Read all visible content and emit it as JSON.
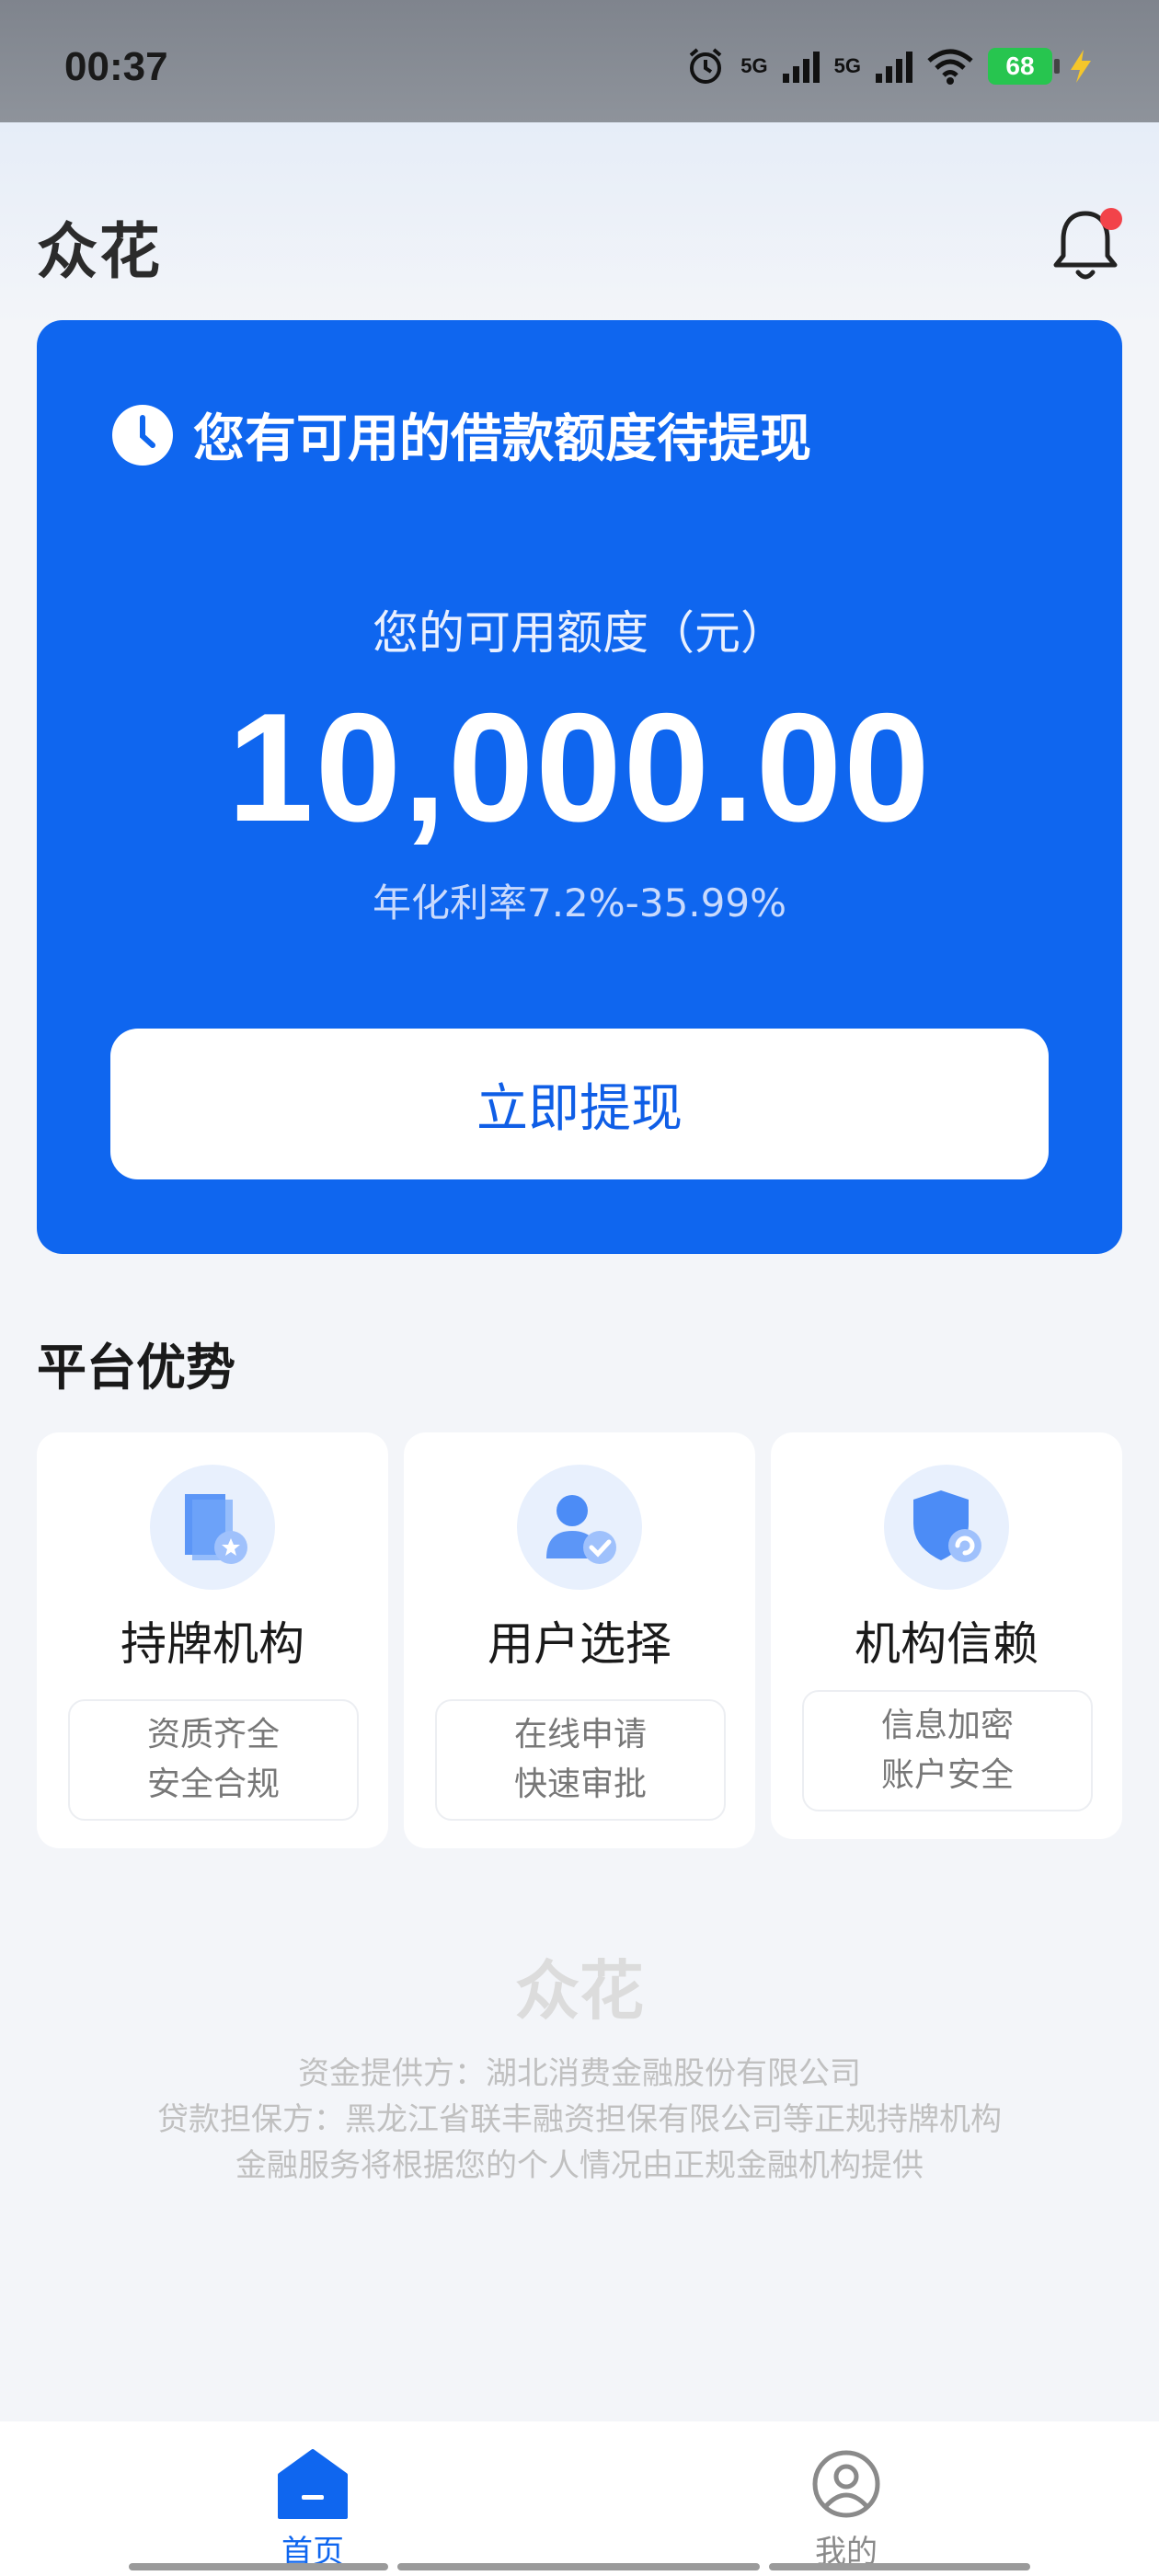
{
  "status_bar": {
    "time": "00:37",
    "signal1": "5G",
    "signal2": "5G",
    "battery": "68"
  },
  "header": {
    "logo": "众花"
  },
  "hero": {
    "title": "您有可用的借款额度待提现",
    "amount_label": "您的可用额度（元）",
    "amount": "10,000.00",
    "rate": "年化利率7.2%-35.99%",
    "withdraw_button": "立即提现"
  },
  "advantages": {
    "title": "平台优势",
    "items": [
      {
        "icon": "license-shield-icon",
        "title": "持牌机构",
        "line1": "资质齐全",
        "line2": "安全合规"
      },
      {
        "icon": "user-check-icon",
        "title": "用户选择",
        "line1": "在线申请",
        "line2": "快速审批"
      },
      {
        "icon": "trust-shield-icon",
        "title": "机构信赖",
        "line1": "信息加密",
        "line2": "账户安全"
      }
    ]
  },
  "footer": {
    "logo": "众花",
    "line1": "资金提供方：湖北消费金融股份有限公司",
    "line2": "贷款担保方：黑龙江省联丰融资担保有限公司等正规持牌机构",
    "line3": "金融服务将根据您的个人情况由正规金融机构提供"
  },
  "tabs": [
    {
      "label": "首页",
      "icon": "home-icon",
      "active": true
    },
    {
      "label": "我的",
      "icon": "profile-icon",
      "active": false
    }
  ],
  "colors": {
    "primary": "#0F66EF",
    "background": "#F3F5F9",
    "notification_dot": "#F2434A"
  }
}
